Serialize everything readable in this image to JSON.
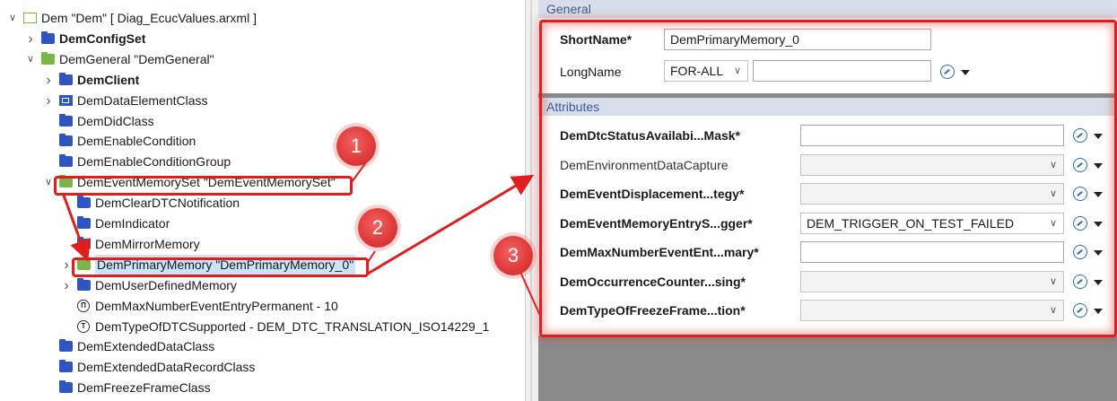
{
  "tree": {
    "rows": [
      {
        "label": "Dem \"Dem\" [ Diag_EcucValues.arxml ]",
        "bold": false,
        "icon": "document-icon",
        "twisty": "expanded"
      },
      {
        "label": "DemConfigSet",
        "bold": true,
        "icon": "folder-icon",
        "twisty": "collapsed"
      },
      {
        "label": "DemGeneral \"DemGeneral\"",
        "bold": false,
        "icon": "open-folder-icon",
        "twisty": "expanded"
      },
      {
        "label": "DemClient",
        "bold": true,
        "icon": "folder-icon",
        "twisty": "collapsed"
      },
      {
        "label": "DemDataElementClass",
        "bold": false,
        "icon": "choice-container-icon",
        "twisty": "collapsed"
      },
      {
        "label": "DemDidClass",
        "bold": false,
        "icon": "folder-icon",
        "twisty": "none"
      },
      {
        "label": "DemEnableCondition",
        "bold": false,
        "icon": "folder-icon",
        "twisty": "none"
      },
      {
        "label": "DemEnableConditionGroup",
        "bold": false,
        "icon": "folder-icon",
        "twisty": "none"
      },
      {
        "label": "DemEventMemorySet \"DemEventMemorySet\"",
        "bold": false,
        "icon": "open-folder-icon",
        "twisty": "expanded"
      },
      {
        "label": "DemClearDTCNotification",
        "bold": false,
        "icon": "folder-icon",
        "twisty": "none"
      },
      {
        "label": "DemIndicator",
        "bold": false,
        "icon": "folder-icon",
        "twisty": "none"
      },
      {
        "label": "DemMirrorMemory",
        "bold": false,
        "icon": "folder-icon",
        "twisty": "none"
      },
      {
        "label": "DemPrimaryMemory \"DemPrimaryMemory_0\"",
        "bold": false,
        "icon": "open-folder-icon",
        "twisty": "collapsed",
        "selected": true
      },
      {
        "label": "DemUserDefinedMemory",
        "bold": false,
        "icon": "folder-icon",
        "twisty": "collapsed"
      },
      {
        "label": "DemMaxNumberEventEntryPermanent - 10",
        "bold": false,
        "icon": "integer-param-icon",
        "twisty": "none"
      },
      {
        "label": "DemTypeOfDTCSupported - DEM_DTC_TRANSLATION_ISO14229_1",
        "bold": false,
        "icon": "enum-param-icon",
        "twisty": "none"
      },
      {
        "label": "DemExtendedDataClass",
        "bold": false,
        "icon": "folder-icon",
        "twisty": "none"
      },
      {
        "label": "DemExtendedDataRecordClass",
        "bold": false,
        "icon": "folder-icon",
        "twisty": "none"
      },
      {
        "label": "DemFreezeFrameClass",
        "bold": false,
        "icon": "folder-icon",
        "twisty": "none"
      }
    ]
  },
  "general": {
    "header": "General",
    "shortname_label": "ShortName*",
    "shortname_value": "DemPrimaryMemory_0",
    "longname_label": "LongName",
    "longname_lang": "FOR-ALL",
    "longname_value": ""
  },
  "attributes": {
    "header": "Attributes",
    "rows": [
      {
        "label": "DemDtcStatusAvailabi...Mask*",
        "bold": true,
        "kind": "text",
        "value": ""
      },
      {
        "label": "DemEnvironmentDataCapture",
        "bold": false,
        "kind": "dropdown-disabled",
        "value": ""
      },
      {
        "label": "DemEventDisplacement...tegy*",
        "bold": true,
        "kind": "dropdown-disabled",
        "value": ""
      },
      {
        "label": "DemEventMemoryEntryS...gger*",
        "bold": true,
        "kind": "dropdown",
        "value": "DEM_TRIGGER_ON_TEST_FAILED"
      },
      {
        "label": "DemMaxNumberEventEnt...mary*",
        "bold": true,
        "kind": "text",
        "value": ""
      },
      {
        "label": "DemOccurrenceCounter...sing*",
        "bold": true,
        "kind": "dropdown-disabled",
        "value": ""
      },
      {
        "label": "DemTypeOfFreezeFrame...tion*",
        "bold": true,
        "kind": "dropdown-disabled",
        "value": ""
      }
    ]
  },
  "annotations": {
    "badges": [
      "1",
      "2",
      "3"
    ],
    "highlight_color": "#e01e1e"
  }
}
